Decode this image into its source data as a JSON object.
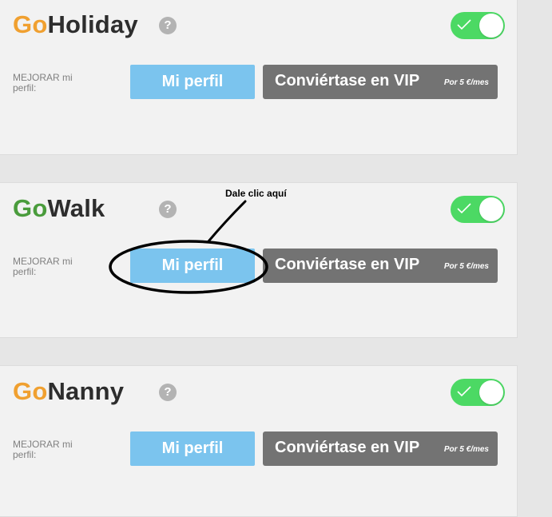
{
  "accent_colors": {
    "orange": "#f0a030",
    "green": "#4a9c3c",
    "toggle_on": "#4cd964",
    "profile_button": "#7bc4ee",
    "vip_button": "#737373"
  },
  "help_icon_glyph": "?",
  "services": [
    {
      "title_prefix": "Go",
      "title_suffix": "Holiday",
      "prefix_color": "#f0a030",
      "upgrade_label": "MEJORAR mi perfil:",
      "profile_button": "Mi perfil",
      "vip_button": "Conviértase en VIP",
      "vip_price": "Por 5 €/mes",
      "toggle_on": true
    },
    {
      "title_prefix": "Go",
      "title_suffix": "Walk",
      "prefix_color": "#4a9c3c",
      "upgrade_label": "MEJORAR mi perfil:",
      "profile_button": "Mi perfil",
      "vip_button": "Conviértase en VIP",
      "vip_price": "Por 5 €/mes",
      "toggle_on": true
    },
    {
      "title_prefix": "Go",
      "title_suffix": "Nanny",
      "prefix_color": "#f0a030",
      "upgrade_label": "MEJORAR mi perfil:",
      "profile_button": "Mi perfil",
      "vip_button": "Conviértase en VIP",
      "vip_price": "Por 5 €/mes",
      "toggle_on": true
    }
  ],
  "annotation": {
    "text": "Dale clic aquí"
  }
}
